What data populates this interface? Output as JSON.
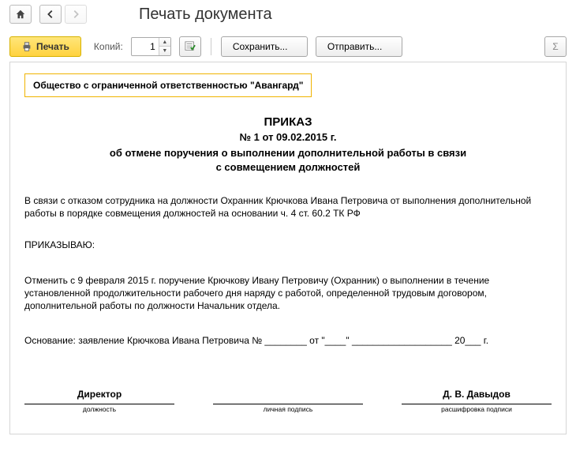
{
  "header": {
    "page_title": "Печать документа"
  },
  "toolbar": {
    "print_label": "Печать",
    "copies_label": "Копий:",
    "copies_value": "1",
    "save_label": "Сохранить...",
    "send_label": "Отправить...",
    "sum_label": "Σ"
  },
  "doc": {
    "org_name": "Общество с ограниченной ответственностью \"Авангард\"",
    "title": "ПРИКАЗ",
    "number_line": "№ 1 от 09.02.2015 г.",
    "subtitle": "об отмене поручения о выполнении дополнительной работы в связи с совмещением должностей",
    "body": "В связи с отказом сотрудника на должности Охранник Крючкова Ивана Петровича от выполнения дополнительной работы в порядке совмещения должностей на основании ч. 4 ст. 60.2 ТК РФ",
    "command": "ПРИКАЗЫВАЮ:",
    "order_text": "Отменить с 9 февраля 2015 г. поручение Крючкову Ивану Петровичу (Охранник) о выполнении в течение установленной продолжительности рабочего дня наряду с работой, определенной трудовым договором, дополнительной работы по должности Начальник отдела.",
    "basis": "Основание: заявление Крючкова Ивана Петровича № ________ от \"____\" ___________________ 20___ г.",
    "sig": {
      "position": "Директор",
      "position_sub": "должность",
      "mid_sub": "личная подпись",
      "name": "Д. В. Давыдов",
      "name_sub": "расшифровка подписи"
    }
  }
}
